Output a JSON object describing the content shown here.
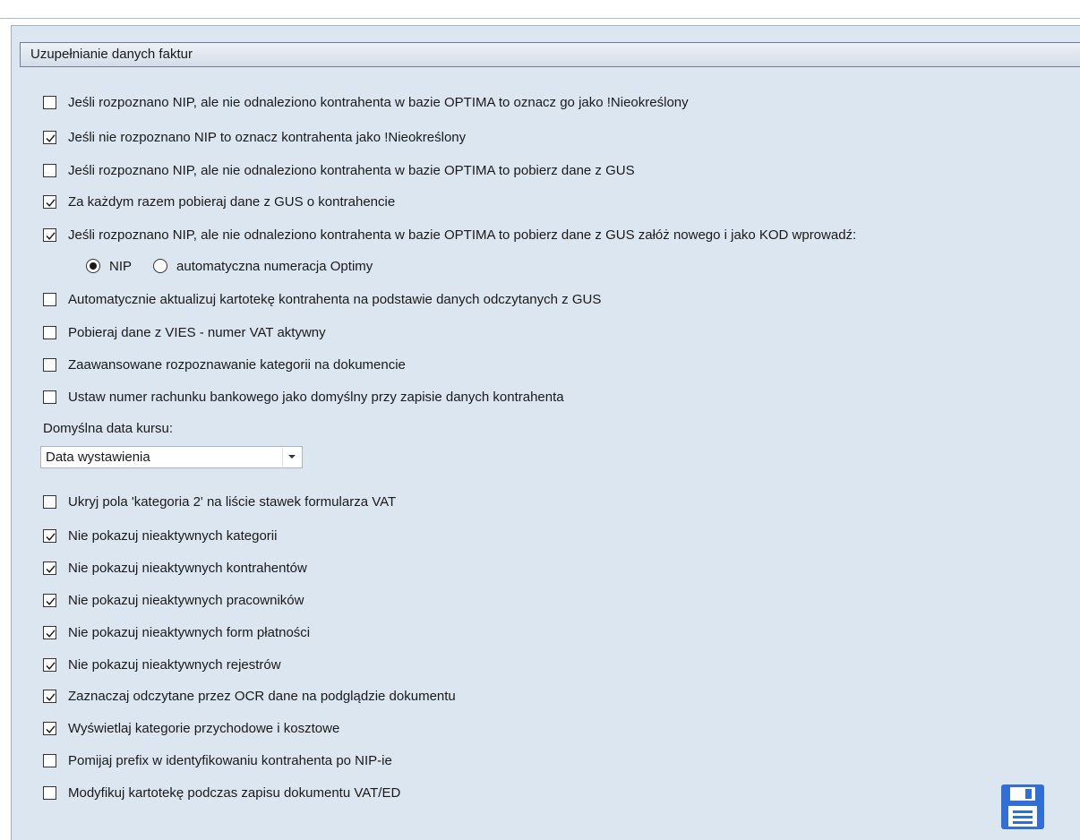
{
  "group": {
    "title": "Uzupełnianie danych faktur"
  },
  "options": [
    {
      "label": "Jeśli rozpoznano NIP, ale nie odnaleziono kontrahenta w bazie OPTIMA to oznacz go jako !Nieokreślony",
      "checked": false
    },
    {
      "label": "Jeśli nie rozpoznano NIP to oznacz kontrahenta jako !Nieokreślony",
      "checked": true
    },
    {
      "label": "Jeśli rozpoznano NIP, ale nie odnaleziono kontrahenta w bazie OPTIMA to pobierz dane z GUS",
      "checked": false
    },
    {
      "label": "Za każdym razem pobieraj dane z GUS o kontrahencie",
      "checked": true
    },
    {
      "label": "Jeśli rozpoznano NIP, ale nie odnaleziono kontrahenta w bazie OPTIMA to pobierz dane z GUS załóż nowego i jako KOD wprowadź:",
      "checked": true
    }
  ],
  "kod_radio": {
    "options": [
      "NIP",
      "automatyczna numeracja Optimy"
    ],
    "selected": "NIP"
  },
  "options2": [
    {
      "label": "Automatycznie aktualizuj kartotekę kontrahenta na podstawie danych odczytanych z GUS",
      "checked": false
    },
    {
      "label": "Pobieraj dane z VIES - numer VAT aktywny",
      "checked": false
    },
    {
      "label": "Zaawansowane rozpoznawanie kategorii na dokumencie",
      "checked": false
    },
    {
      "label": "Ustaw numer rachunku bankowego jako domyślny przy zapisie danych kontrahenta",
      "checked": false
    }
  ],
  "kurs": {
    "label": "Domyślna data kursu:",
    "value": "Data wystawienia"
  },
  "options3": [
    {
      "label": "Ukryj pola 'kategoria 2' na liście stawek formularza VAT",
      "checked": false
    },
    {
      "label": "Nie pokazuj nieaktywnych kategorii",
      "checked": true
    },
    {
      "label": "Nie pokazuj nieaktywnych kontrahentów",
      "checked": true
    },
    {
      "label": "Nie pokazuj nieaktywnych pracowników",
      "checked": true
    },
    {
      "label": "Nie pokazuj nieaktywnych form płatności",
      "checked": true
    },
    {
      "label": "Nie pokazuj nieaktywnych rejestrów",
      "checked": true
    },
    {
      "label": "Zaznaczaj odczytane przez OCR dane na podglądzie dokumentu",
      "checked": true
    },
    {
      "label": "Wyświetlaj kategorie przychodowe i kosztowe",
      "checked": true
    },
    {
      "label": "Pomijaj prefix w identyfikowaniu kontrahenta po NIP-ie",
      "checked": false
    },
    {
      "label": "Modyfikuj kartotekę podczas zapisu dokumentu VAT/ED",
      "checked": false
    }
  ],
  "toolbar": {
    "save_icon": "floppy-disk-icon",
    "accent_color": "#2f6fd6"
  }
}
